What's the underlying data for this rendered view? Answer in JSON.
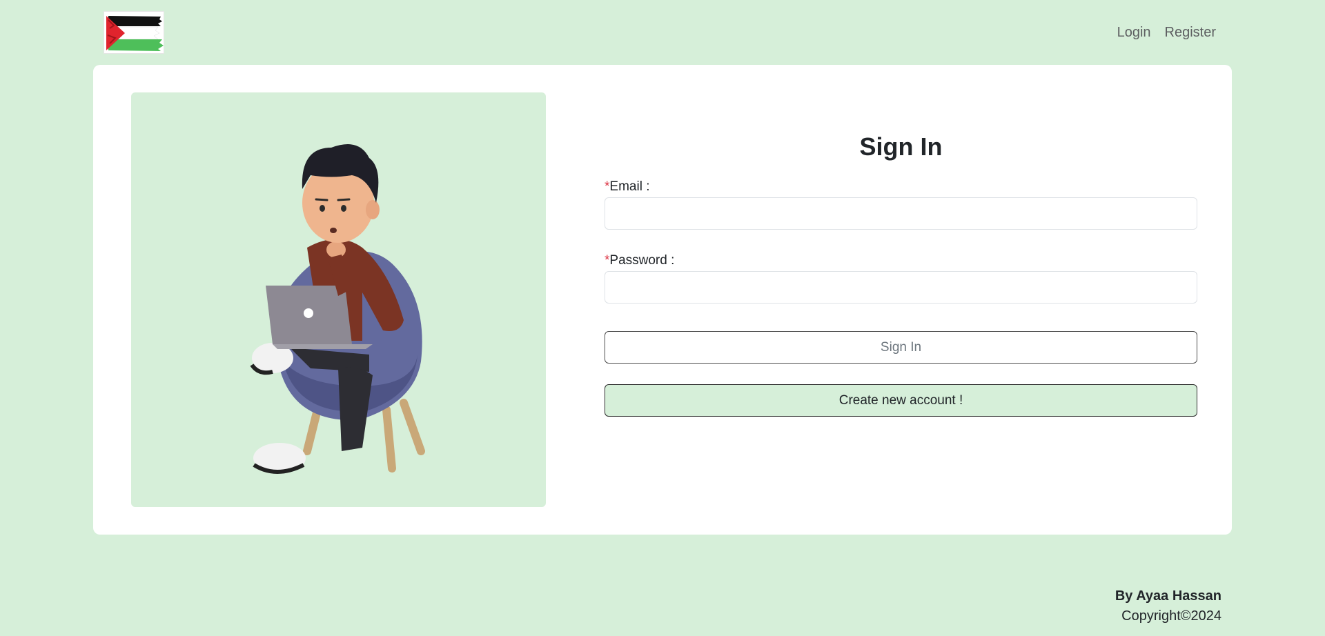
{
  "nav": {
    "logo_alt": "Palestine flag logo",
    "links": [
      "Login",
      "Register"
    ]
  },
  "form": {
    "title": "Sign In",
    "required_mark": "*",
    "email_label": "Email :",
    "email_value": "",
    "password_label": "Password :",
    "password_value": "",
    "signin_label": "Sign In",
    "create_label": "Create new account !"
  },
  "footer": {
    "author": "By Ayaa Hassan",
    "copyright": "Copyright©2024"
  },
  "colors": {
    "background": "#d6efd9",
    "card": "#ffffff",
    "required": "#dc3545"
  },
  "icons": {
    "logo": "palestine-flag-icon",
    "illustration": "boy-on-chair-with-laptop"
  }
}
